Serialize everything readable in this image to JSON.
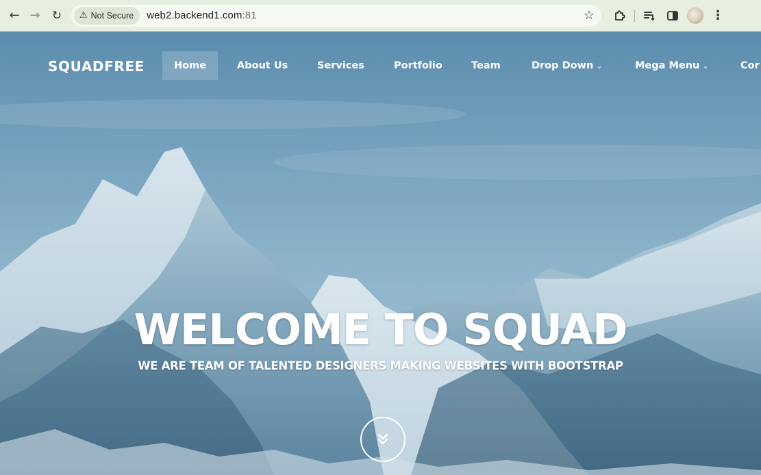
{
  "browser": {
    "security_label": "Not Secure",
    "url_host": "web2.backend1.com",
    "url_port": ":81"
  },
  "site": {
    "brand": "SQUADFREE",
    "nav": [
      {
        "label": "Home",
        "active": true
      },
      {
        "label": "About Us"
      },
      {
        "label": "Services"
      },
      {
        "label": "Portfolio"
      },
      {
        "label": "Team"
      },
      {
        "label": "Drop Down",
        "has_caret": true
      },
      {
        "label": "Mega Menu",
        "has_caret": true
      },
      {
        "label": "Cor"
      }
    ],
    "hero": {
      "headline": "WELCOME TO SQUAD",
      "subline": "WE ARE TEAM OF TALENTED DESIGNERS MAKING WEBSITES WITH BOOTSTRAP"
    }
  },
  "icons": {
    "back": "arrow-left-icon",
    "forward": "arrow-right-icon",
    "reload": "reload-icon",
    "warning": "warning-triangle-icon",
    "bookmark": "star-icon",
    "extensions": "puzzle-icon",
    "reading_list": "reading-list-icon",
    "side_panel": "side-panel-icon",
    "menu": "kebab-menu-icon",
    "scroll": "double-chevron-down-icon"
  }
}
